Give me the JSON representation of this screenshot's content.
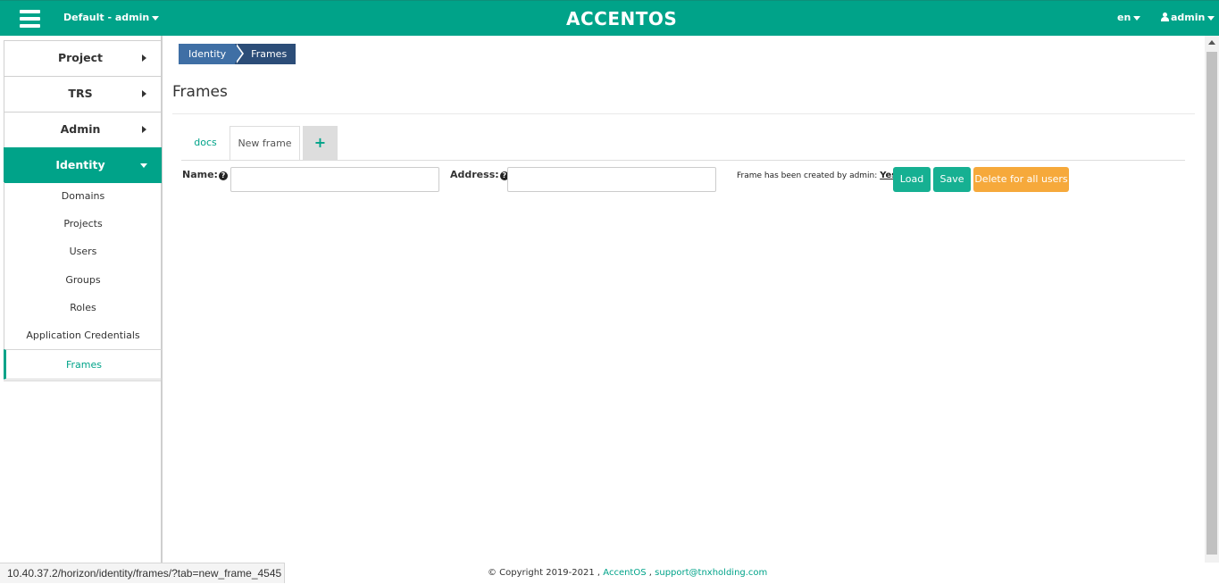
{
  "header": {
    "project_switcher": "Default - admin",
    "brand": "ACCENTOS",
    "language": "en",
    "user": "admin"
  },
  "sidebar": {
    "groups": [
      {
        "label": "Project"
      },
      {
        "label": "TRS"
      },
      {
        "label": "Admin"
      },
      {
        "label": "Identity"
      }
    ],
    "identity_items": [
      {
        "label": "Domains"
      },
      {
        "label": "Projects"
      },
      {
        "label": "Users"
      },
      {
        "label": "Groups"
      },
      {
        "label": "Roles"
      },
      {
        "label": "Application Credentials"
      },
      {
        "label": "Frames"
      }
    ],
    "active_group": "Identity",
    "active_item": "Frames"
  },
  "breadcrumb": {
    "items": [
      "Identity",
      "Frames"
    ]
  },
  "page": {
    "title": "Frames"
  },
  "tabs": {
    "items": [
      "docs",
      "New frame"
    ],
    "add_label": "+",
    "active": "New frame"
  },
  "form": {
    "name_label": "Name:",
    "name_value": "",
    "address_label": "Address:",
    "address_value": "",
    "help_glyph": "?",
    "created_text": "Frame has been created by admin:",
    "created_value": "Yes",
    "buttons": {
      "load": "Load",
      "save": "Save",
      "delete": "Delete for all users"
    }
  },
  "footer": {
    "status_url": "10.40.37.2/horizon/identity/frames/?tab=new_frame_4545",
    "copyright": "© Copyright 2019-2021 ,",
    "company_link": "AccentOS",
    "separator": ",",
    "email_link": "support@tnxholding.com"
  },
  "colors": {
    "brand": "#00a389",
    "breadcrumb_primary": "#3f6fa5",
    "breadcrumb_active": "#2c4d78",
    "button_primary": "#16b092",
    "button_warning": "#f6a93b"
  }
}
